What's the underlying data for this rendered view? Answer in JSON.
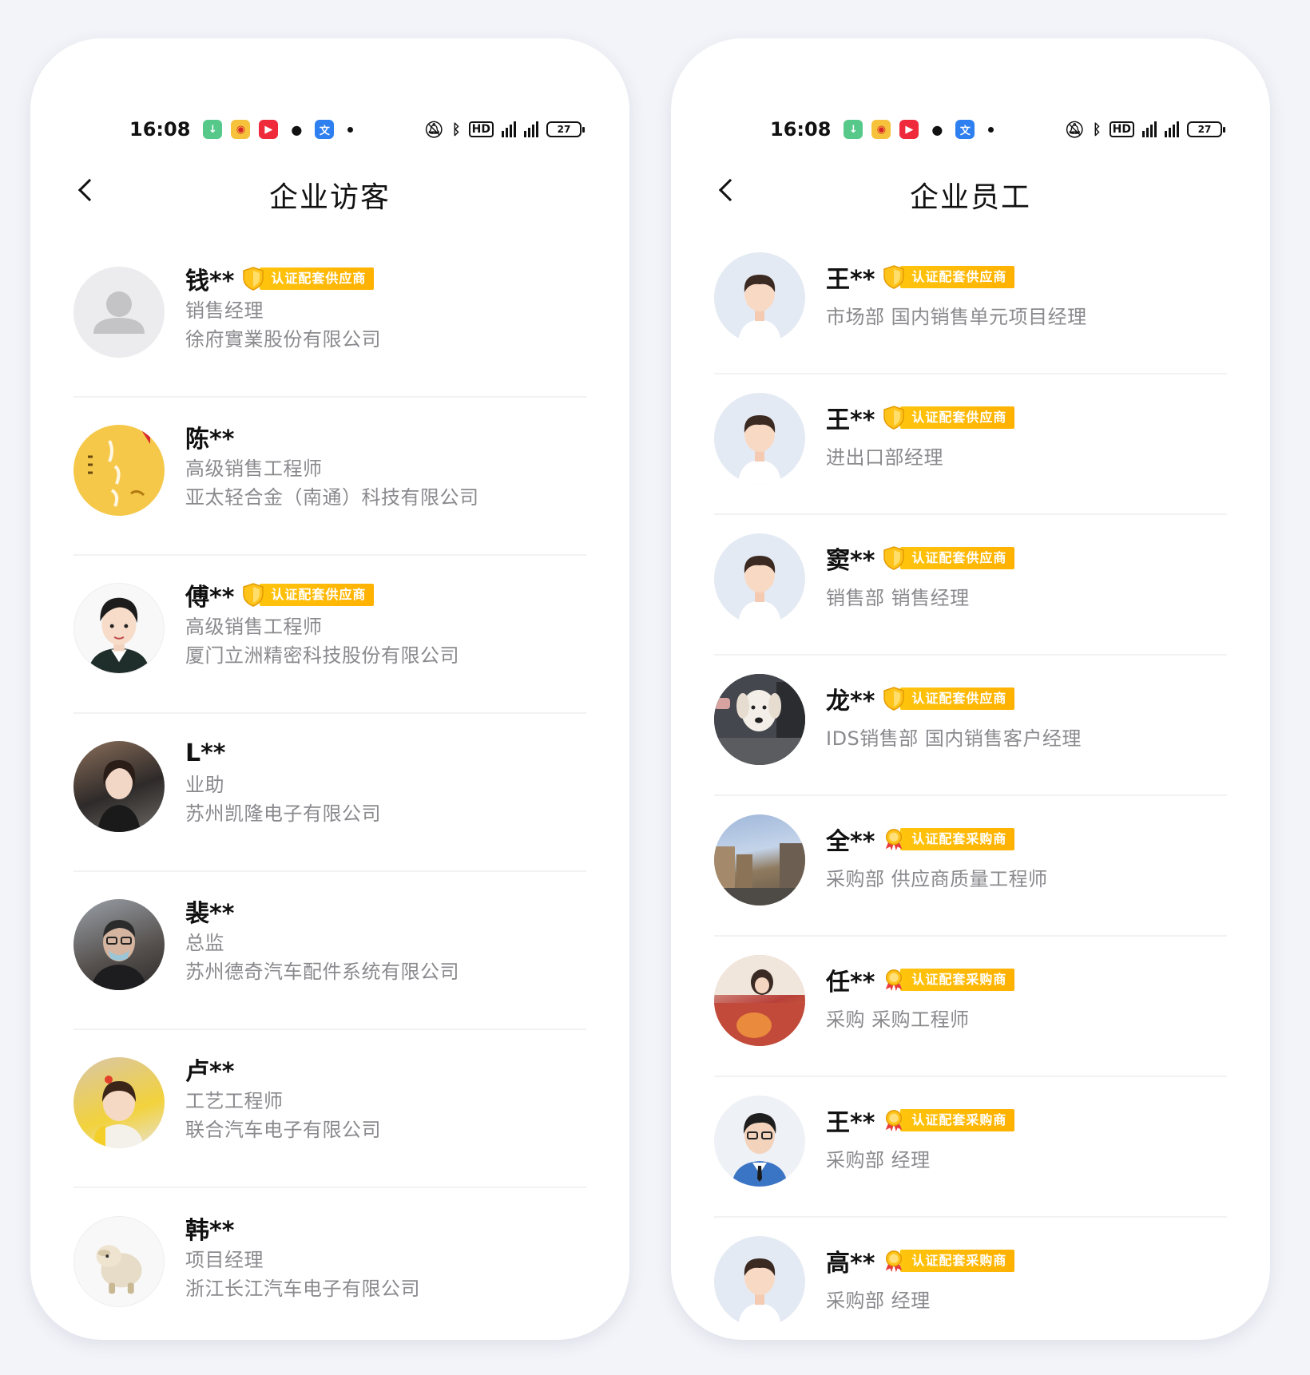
{
  "status_bar": {
    "time": "16:08",
    "battery": "27"
  },
  "badges": {
    "supplier": "认证配套供应商",
    "purchaser": "认证配套采购商"
  },
  "visitors": {
    "title": "企业访客",
    "items": [
      {
        "name": "钱**",
        "badge": "认证配套供应商",
        "line1": "销售经理",
        "line2": "徐府實業股份有限公司"
      },
      {
        "name": "陈**",
        "line1": "高级销售工程师",
        "line2": "亚太轻合金（南通）科技有限公司"
      },
      {
        "name": "傅**",
        "badge": "认证配套供应商",
        "line1": "高级销售工程师",
        "line2": "厦门立洲精密科技股份有限公司"
      },
      {
        "name": "L**",
        "line1": "业助",
        "line2": "苏州凯隆电子有限公司"
      },
      {
        "name": "裴**",
        "line1": "总监",
        "line2": "苏州德奇汽车配件系统有限公司"
      },
      {
        "name": "卢**",
        "line1": "工艺工程师",
        "line2": "联合汽车电子有限公司"
      },
      {
        "name": "韩**",
        "line1": "项目经理",
        "line2": "浙江长江汽车电子有限公司"
      }
    ]
  },
  "employees": {
    "title": "企业员工",
    "items": [
      {
        "name": "王**",
        "badge": "认证配套供应商",
        "line1": "市场部  国内销售单元项目经理"
      },
      {
        "name": "王**",
        "badge": "认证配套供应商",
        "line1": "进出口部经理"
      },
      {
        "name": "窦**",
        "badge": "认证配套供应商",
        "line1": "销售部  销售经理"
      },
      {
        "name": "龙**",
        "badge": "认证配套供应商",
        "line1": "IDS销售部  国内销售客户经理"
      },
      {
        "name": "全**",
        "badge": "认证配套采购商",
        "line1": "采购部  供应商质量工程师"
      },
      {
        "name": "任**",
        "badge": "认证配套采购商",
        "line1": "采购  采购工程师"
      },
      {
        "name": "王**",
        "badge": "认证配套采购商",
        "line1": "采购部  经理"
      },
      {
        "name": "高**",
        "badge": "认证配套采购商",
        "line1": "采购部  经理"
      }
    ]
  },
  "colors": {
    "badge_gold": "#ffb800",
    "text_primary": "#111111",
    "text_secondary": "#8a8a8e",
    "background": "#f3f4f9"
  },
  "icons": [
    "back-arrow-icon",
    "shield-icon",
    "medal-icon",
    "default-avatar-icon",
    "male-avatar-icon",
    "mute-icon",
    "bluetooth-icon",
    "hd-icon",
    "signal-icon",
    "battery-icon"
  ]
}
